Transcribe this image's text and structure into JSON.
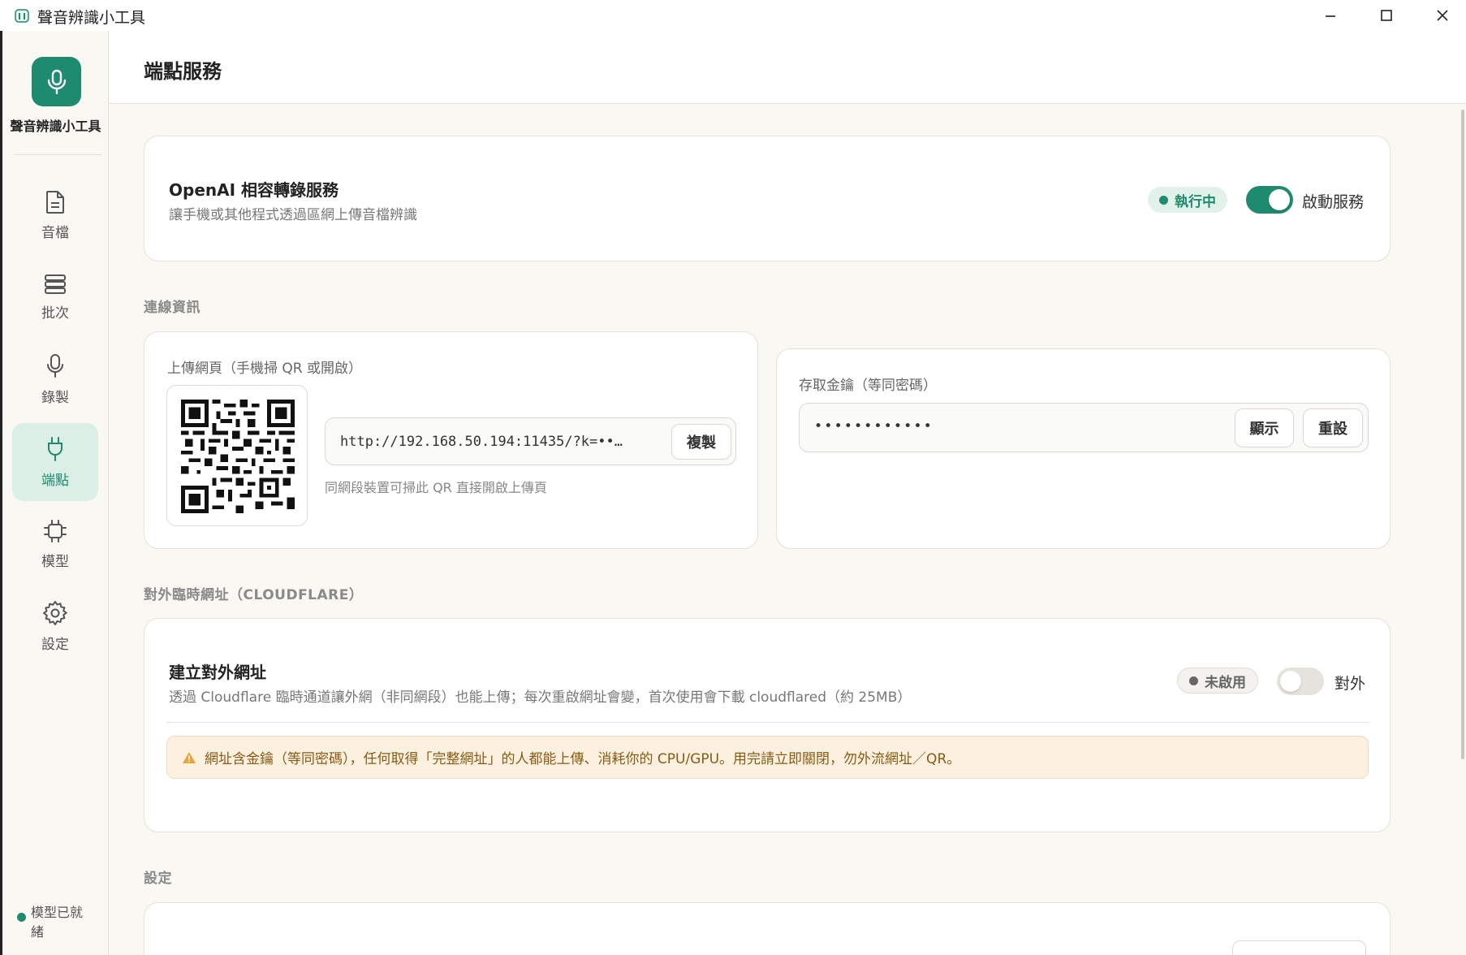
{
  "window": {
    "title": "聲音辨識小工具",
    "controls": [
      "minimize",
      "maximize",
      "close"
    ]
  },
  "sidebar": {
    "app_name": "聲音辨識小工具",
    "items": [
      {
        "label": "音檔",
        "icon": "file-icon"
      },
      {
        "label": "批次",
        "icon": "stack-icon"
      },
      {
        "label": "錄製",
        "icon": "microphone-icon"
      },
      {
        "label": "端點",
        "icon": "plug-icon",
        "active": true
      },
      {
        "label": "模型",
        "icon": "chip-icon"
      },
      {
        "label": "設定",
        "icon": "gear-icon"
      }
    ],
    "status_text": "模型已就緒"
  },
  "header": {
    "title": "端點服務"
  },
  "service": {
    "title": "OpenAI 相容轉錄服務",
    "subtitle": "讓手機或其他程式透過區網上傳音檔辨識",
    "status": "執行中",
    "toggle_label": "啟動服務",
    "enabled": true
  },
  "connection": {
    "section_label": "連線資訊",
    "upload_title": "上傳網頁（手機掃 QR 或開啟）",
    "url": "http://192.168.50.194:11435/?k=••…",
    "copy_label": "複製",
    "hint": "同網段裝置可掃此 QR 直接開啟上傳頁",
    "key_title": "存取金鑰（等同密碼）",
    "key_value": "••••••••••••",
    "show_label": "顯示",
    "reset_label": "重設"
  },
  "cloudflare": {
    "section_label": "對外臨時網址（CLOUDFLARE）",
    "title": "建立對外網址",
    "subtitle": "透過 Cloudflare 臨時通道讓外網（非同網段）也能上傳；每次重啟網址會變，首次使用會下載 cloudflared（約 25MB）",
    "status": "未啟用",
    "toggle_label": "對外",
    "enabled": false,
    "warning": "網址含金鑰（等同密碼），任何取得「完整網址」的人都能上傳、消耗你的 CPU/GPU。用完請立即關閉，勿外流網址／QR。"
  },
  "settings": {
    "section_label": "設定"
  },
  "colors": {
    "accent": "#1e8a6e",
    "accent_light": "#dcefe6",
    "warning_bg": "#fcf1e0",
    "warning_text": "#8a5a14"
  }
}
